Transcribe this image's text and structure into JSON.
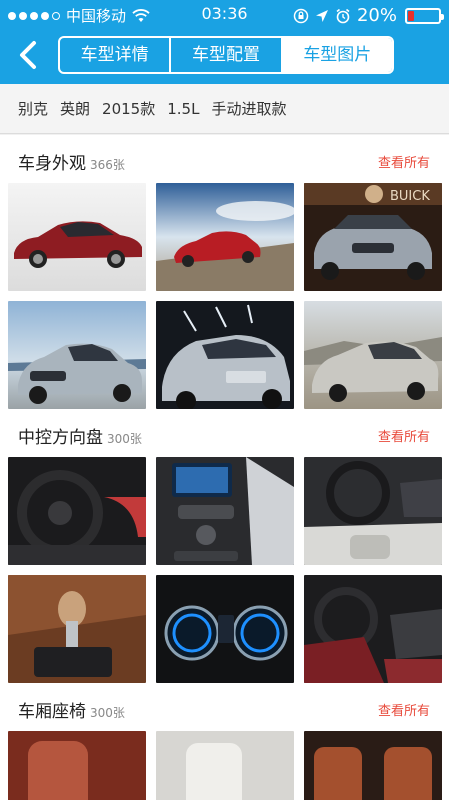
{
  "status": {
    "carrier": "中国移动",
    "time": "03:36",
    "battery": "20%",
    "battery_level": 0.2
  },
  "nav": {
    "tabs": [
      {
        "label": "车型详情",
        "active": false
      },
      {
        "label": "车型配置",
        "active": false
      },
      {
        "label": "车型图片",
        "active": true
      }
    ]
  },
  "breadcrumb": {
    "items": [
      "别克",
      "英朗",
      "2015款",
      "1.5L",
      "手动进取款"
    ]
  },
  "sections": [
    {
      "title": "车身外观",
      "count": "366张",
      "more": "查看所有"
    },
    {
      "title": "中控方向盘",
      "count": "300张",
      "more": "查看所有"
    },
    {
      "title": "车厢座椅",
      "count": "300张",
      "more": "查看所有"
    }
  ],
  "photo_watermarks": {
    "brand_sign": "BUICK"
  }
}
